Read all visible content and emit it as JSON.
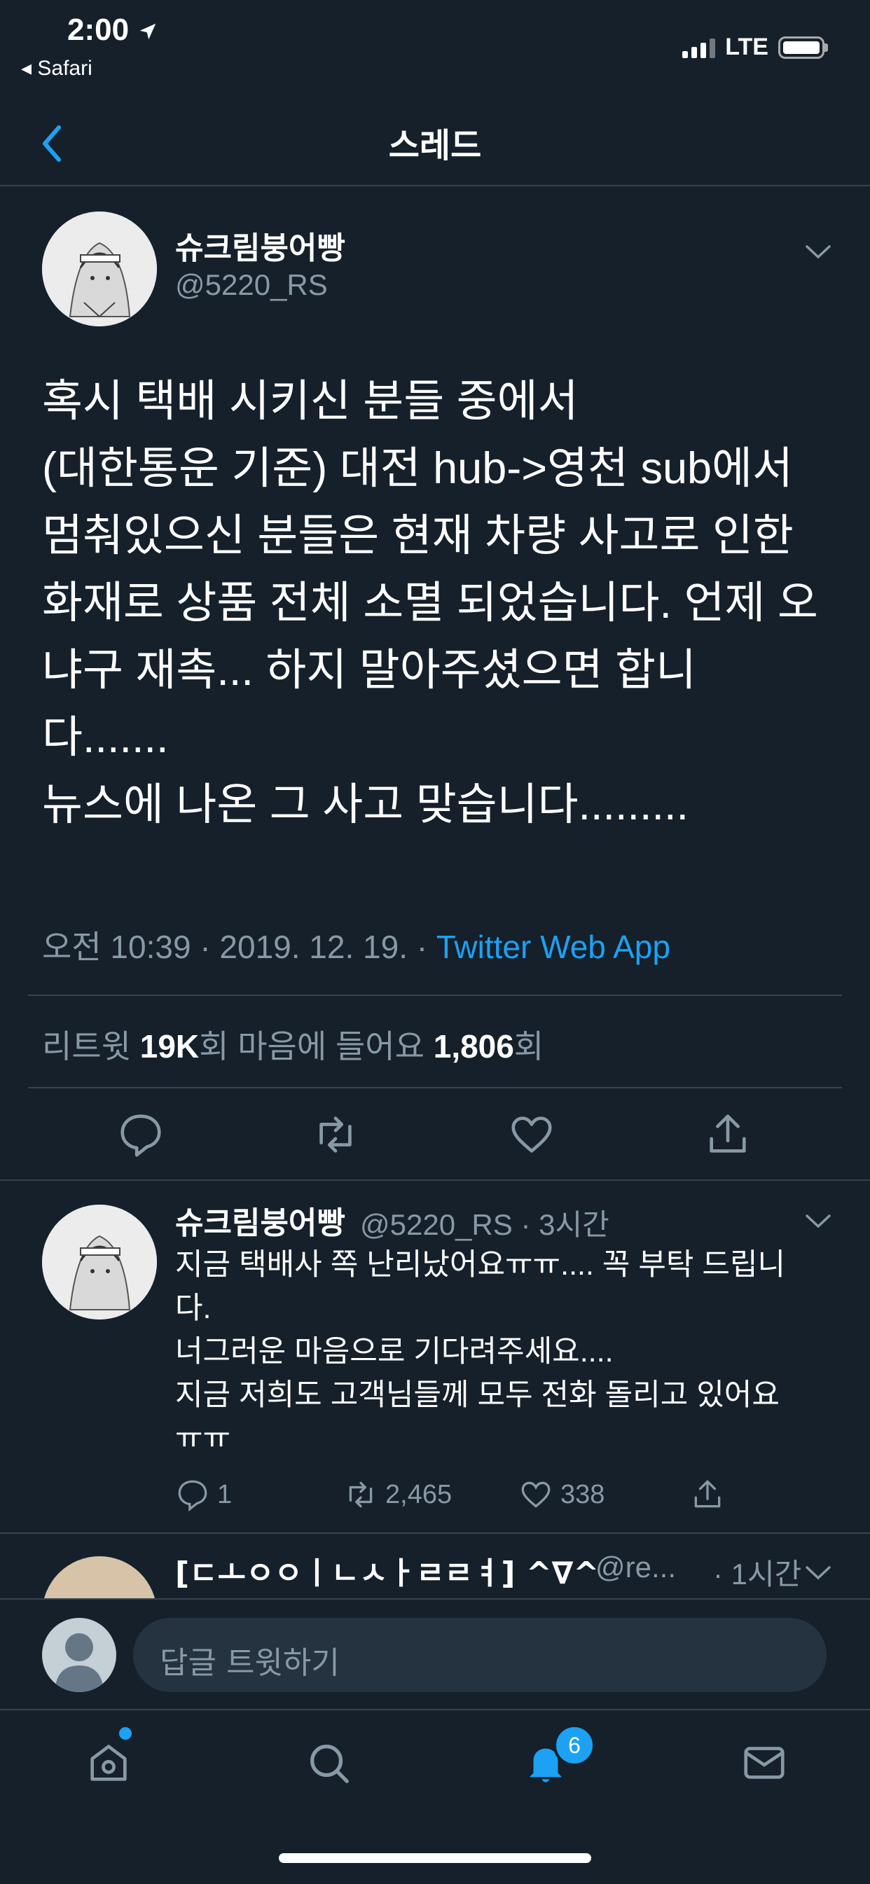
{
  "status_bar": {
    "time": "2:00",
    "back_app": "◂ Safari",
    "network": "LTE"
  },
  "header": {
    "title": "스레드"
  },
  "tweet": {
    "name": "슈크림붕어빵",
    "handle": "@5220_RS",
    "text": "혹시 택배 시키신 분들 중에서\n(대한통운 기준) 대전 hub->영천 sub에서\n멈춰있으신 분들은 현재 차량 사고로 인한\n화재로 상품 전체 소멸 되었습니다. 언제 오\n냐구 재촉... 하지 말아주셨으면 합니\n다.......\n뉴스에 나온 그 사고 맞습니다.........",
    "timestamp": "오전 10:39 · 2019. 12. 19. · ",
    "source": "Twitter Web App",
    "retweets_label": "리트윗 ",
    "retweets": "19K",
    "retweets_suffix": "회  마음에 들어요 ",
    "likes": "1,806",
    "likes_suffix": "회"
  },
  "reply": {
    "name": "슈크림붕어빵",
    "meta": "@5220_RS · 3시간",
    "text": "지금 택배사 쪽 난리났어요ㅠㅠ.... 꼭 부탁 드립니\n다.\n너그러운 마음으로 기다려주세요....\n지금 저희도 고객님들께 모두 전화 돌리고 있어요\nㅠㅠ",
    "replies": "1",
    "retweets": "2,465",
    "likes": "338"
  },
  "next_reply": {
    "name": "[ㄷㅗㅇㅇㅣㄴㅅㅏㄹㄹㅕ] ^∇^",
    "handle": "@re...",
    "time": "· 1시간"
  },
  "composer": {
    "placeholder": "답글 트윗하기"
  },
  "tabbar": {
    "notifications_badge": "6"
  },
  "colors": {
    "background": "#15202b",
    "accent": "#1da1f2",
    "muted": "#8899a6",
    "divider": "#38444d"
  }
}
